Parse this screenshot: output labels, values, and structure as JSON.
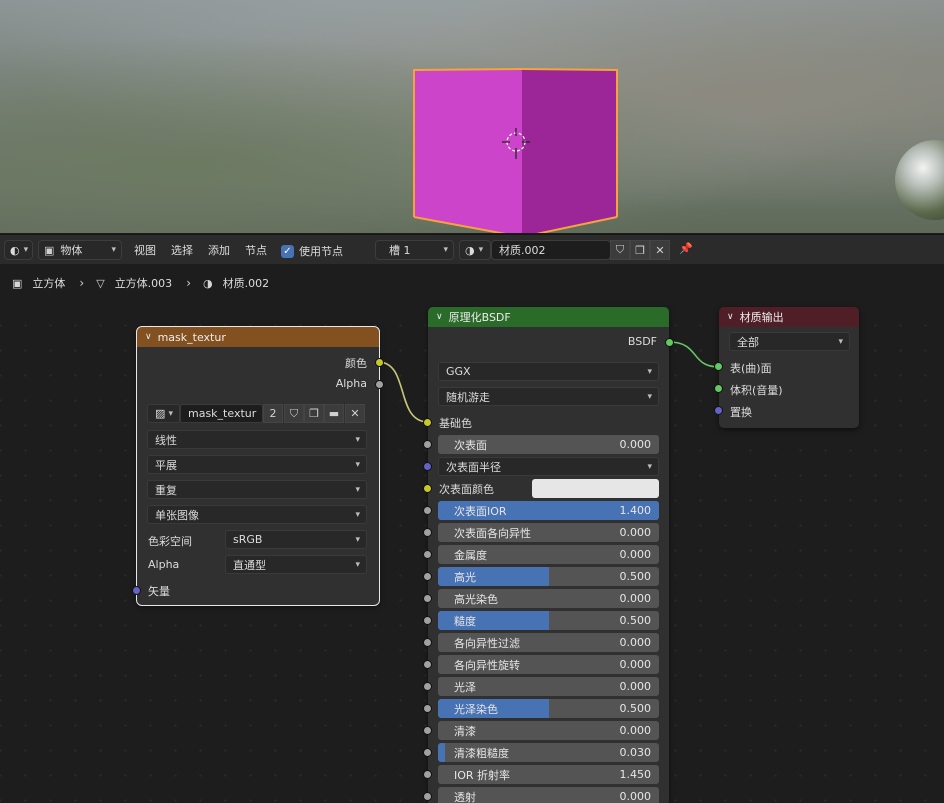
{
  "header": {
    "mode_select": "物体",
    "menus": [
      "视图",
      "选择",
      "添加",
      "节点"
    ],
    "use_nodes_label": "使用节点",
    "slot_select": "槽 1",
    "material_name": "材质.002"
  },
  "breadcrumb": {
    "object": "立方体",
    "mesh": "立方体.003",
    "material": "材质.002"
  },
  "image_node": {
    "title": "mask_textur",
    "out_color": "颜色",
    "out_alpha": "Alpha",
    "image_name": "mask_textur",
    "users": "2",
    "interpolation": "线性",
    "projection": "平展",
    "extension": "重复",
    "source": "单张图像",
    "colorspace_label": "色彩空间",
    "colorspace_value": "sRGB",
    "alpha_label": "Alpha",
    "alpha_value": "直通型",
    "in_vector": "矢量",
    "colors": {
      "header": "#83501f"
    }
  },
  "bsdf_node": {
    "title": "原理化BSDF",
    "out_bsdf": "BSDF",
    "distribution": "GGX",
    "subsurface_method": "随机游走",
    "base_color": "基础色",
    "subsurface": {
      "label": "次表面",
      "value": "0.000",
      "fill": 0
    },
    "subsurface_radius": "次表面半径",
    "subsurface_color": "次表面颜色",
    "params": [
      {
        "label": "次表面IOR",
        "value": "1.400",
        "fill": 1.0
      },
      {
        "label": "次表面各向异性",
        "value": "0.000",
        "fill": 0
      },
      {
        "label": "金属度",
        "value": "0.000",
        "fill": 0
      },
      {
        "label": "高光",
        "value": "0.500",
        "fill": 0.5
      },
      {
        "label": "高光染色",
        "value": "0.000",
        "fill": 0
      },
      {
        "label": "糙度",
        "value": "0.500",
        "fill": 0.5
      },
      {
        "label": "各向异性过滤",
        "value": "0.000",
        "fill": 0
      },
      {
        "label": "各向异性旋转",
        "value": "0.000",
        "fill": 0
      },
      {
        "label": "光泽",
        "value": "0.000",
        "fill": 0
      },
      {
        "label": "光泽染色",
        "value": "0.500",
        "fill": 0.5
      },
      {
        "label": "清漆",
        "value": "0.000",
        "fill": 0
      },
      {
        "label": "清漆粗糙度",
        "value": "0.030",
        "fill": 0.03
      },
      {
        "label": "IOR 折射率",
        "value": "1.450",
        "fill": 0
      },
      {
        "label": "透射",
        "value": "0.000",
        "fill": 0
      }
    ],
    "colors": {
      "header": "#2a6b2a"
    }
  },
  "output_node": {
    "title": "材质输出",
    "target": "全部",
    "in_surface": "表(曲)面",
    "in_volume": "体积(音量)",
    "in_displacement": "置换",
    "colors": {
      "header": "#4f1e26"
    }
  }
}
